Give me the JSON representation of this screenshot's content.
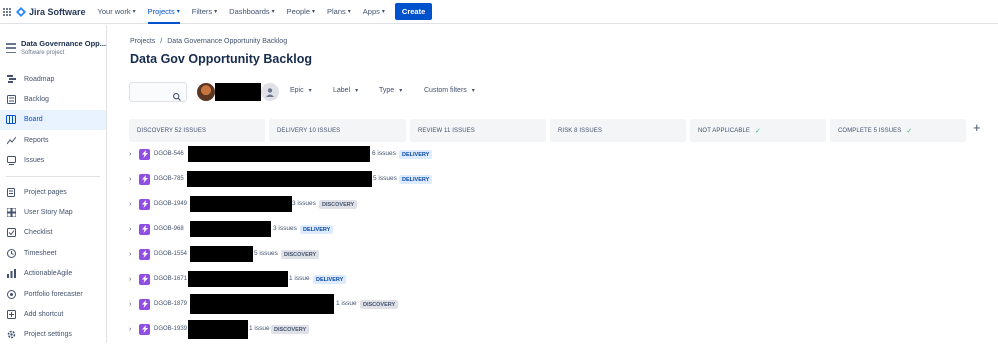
{
  "topnav": {
    "logo": "Jira Software",
    "items": [
      {
        "label": "Your work",
        "active": false
      },
      {
        "label": "Projects",
        "active": true
      },
      {
        "label": "Filters",
        "active": false
      },
      {
        "label": "Dashboards",
        "active": false
      },
      {
        "label": "People",
        "active": false
      },
      {
        "label": "Plans",
        "active": false
      },
      {
        "label": "Apps",
        "active": false
      }
    ],
    "create_label": "Create"
  },
  "sidebar": {
    "project_name": "Data Governance Opp...",
    "project_type": "Software project",
    "items": [
      {
        "label": "Roadmap",
        "icon": "roadmap-icon",
        "active": false
      },
      {
        "label": "Backlog",
        "icon": "backlog-icon",
        "active": false
      },
      {
        "label": "Board",
        "icon": "board-icon",
        "active": true
      },
      {
        "label": "Reports",
        "icon": "reports-icon",
        "active": false
      },
      {
        "label": "Issues",
        "icon": "issues-icon",
        "active": false
      }
    ],
    "items2": [
      {
        "label": "Project pages",
        "icon": "pages-icon"
      },
      {
        "label": "User Story Map",
        "icon": "story-map-icon"
      },
      {
        "label": "Checklist",
        "icon": "checklist-icon"
      },
      {
        "label": "Timesheet",
        "icon": "timesheet-icon"
      },
      {
        "label": "ActionableAgile",
        "icon": "actionable-agile-icon"
      },
      {
        "label": "Portfolio forecaster",
        "icon": "forecaster-icon"
      },
      {
        "label": "Add shortcut",
        "icon": "add-shortcut-icon"
      },
      {
        "label": "Project settings",
        "icon": "settings-icon"
      }
    ]
  },
  "main": {
    "breadcrumb": [
      "Projects",
      "Data Governance Opportunity Backlog"
    ],
    "title": "Data Gov Opportunity Backlog",
    "filters": [
      "Epic",
      "Label",
      "Type",
      "Custom filters"
    ],
    "columns": [
      {
        "label": "DISCOVERY 52 ISSUES",
        "check": false
      },
      {
        "label": "DELIVERY 10 ISSUES",
        "check": false
      },
      {
        "label": "REVIEW 11 ISSUES",
        "check": false
      },
      {
        "label": "RISK 8 ISSUES",
        "check": false
      },
      {
        "label": "NOT APPLICABLE",
        "check": true
      },
      {
        "label": "COMPLETE 5 ISSUES",
        "check": true
      }
    ],
    "rows": [
      {
        "key": "DGOB-546",
        "count": "6 issues",
        "label": "DELIVERY"
      },
      {
        "key": "DGOB-785",
        "count": "5 issues",
        "label": "DELIVERY"
      },
      {
        "key": "DGOB-1949",
        "count": "3 issues",
        "label": "DISCOVERY"
      },
      {
        "key": "DGOB-968",
        "count": "3 issues",
        "label": "DELIVERY"
      },
      {
        "key": "DGOB-1554",
        "count": "5 issues",
        "label": "DISCOVERY"
      },
      {
        "key": "DGOB-1671",
        "count": "1 issue",
        "label": "DELIVERY"
      },
      {
        "key": "DGOB-1879",
        "count": "1 issue",
        "label": "DISCOVERY"
      },
      {
        "key": "DGOB-1939",
        "count": "1 issue",
        "label": "DISCOVERY"
      }
    ]
  },
  "colors": {
    "brand": "#0052cc",
    "epic": "#904ee2",
    "delivery_bg": "#deebff",
    "discovery_bg": "#dfe1e6"
  }
}
